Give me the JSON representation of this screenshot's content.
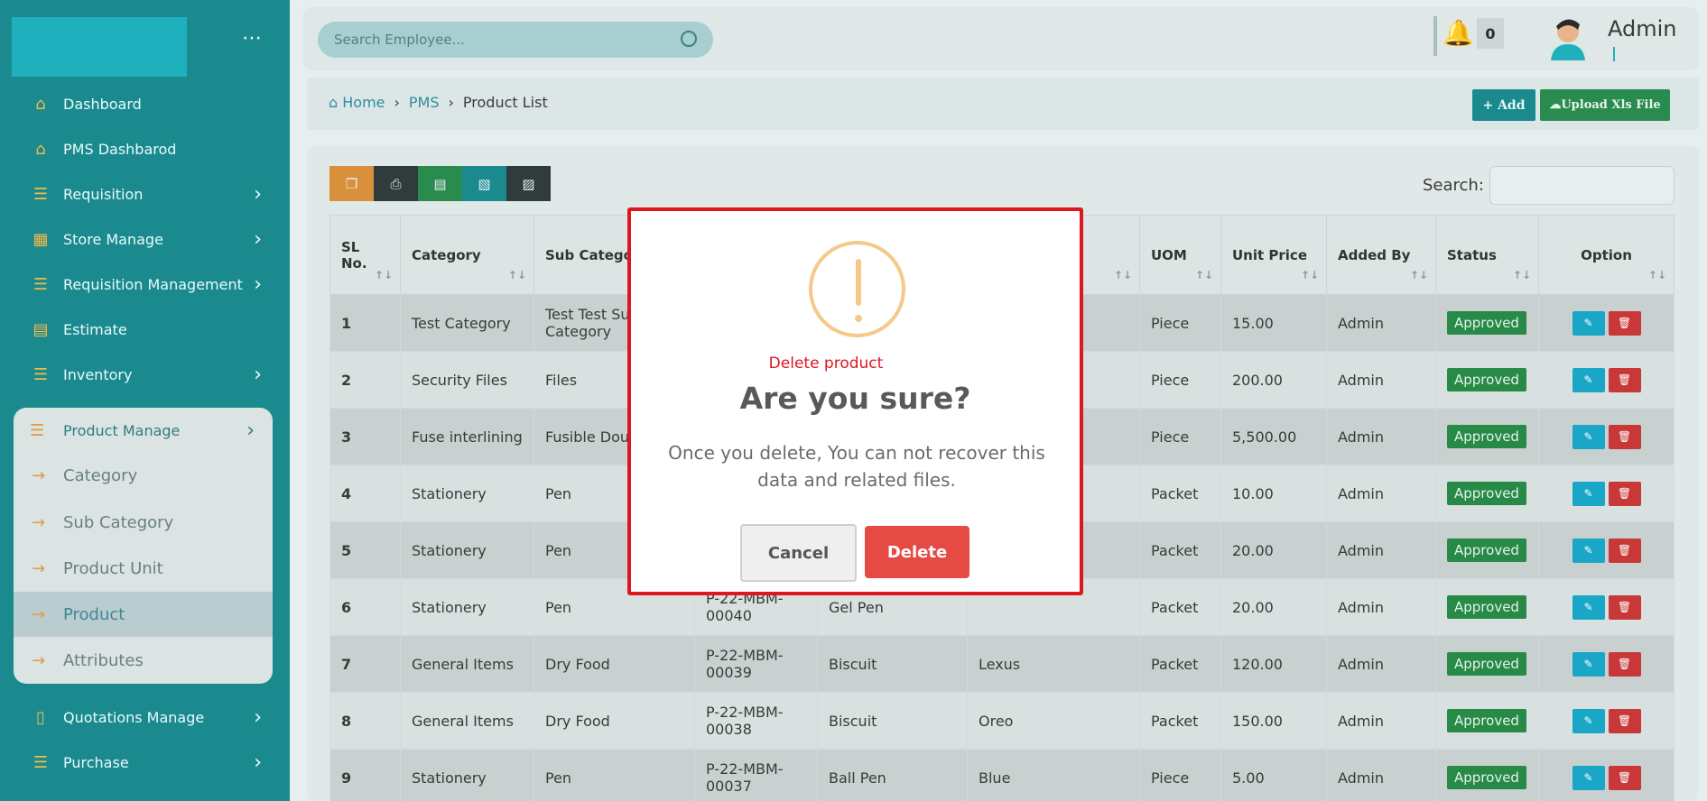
{
  "sidebar": {
    "items": [
      {
        "label": "Dashboard",
        "icon": "home-icon"
      },
      {
        "label": "PMS Dashbarod",
        "icon": "home-icon"
      },
      {
        "label": "Requisition",
        "icon": "list-icon"
      },
      {
        "label": "Store Manage",
        "icon": "store-icon"
      },
      {
        "label": "Requisition Management",
        "icon": "list-icon"
      },
      {
        "label": "Estimate",
        "icon": "calculator-icon"
      },
      {
        "label": "Inventory",
        "icon": "list-icon"
      }
    ],
    "product_manage": {
      "label": "Product Manage",
      "children": [
        "Category",
        "Sub Category",
        "Product Unit",
        "Product",
        "Attributes"
      ],
      "active": "Product"
    },
    "bottom_items": [
      {
        "label": "Quotations Manage",
        "icon": "document-icon"
      },
      {
        "label": "Purchase",
        "icon": "list-icon"
      }
    ]
  },
  "header": {
    "search_placeholder": "Search Employee...",
    "notification_count": "0",
    "user_name": "Admin"
  },
  "breadcrumb": {
    "home": "Home",
    "pms": "PMS",
    "current": "Product List"
  },
  "actions": {
    "add": "+ Add",
    "upload": "Upload Xls File"
  },
  "table": {
    "search_label": "Search:",
    "columns": [
      {
        "label": "SL No."
      },
      {
        "label": "Category"
      },
      {
        "label": "Sub Catego"
      },
      {
        "label": ""
      },
      {
        "label": ""
      },
      {
        "label": ""
      },
      {
        "label": "UOM"
      },
      {
        "label": "Unit Price"
      },
      {
        "label": "Added By"
      },
      {
        "label": "Status"
      },
      {
        "label": "Option"
      }
    ],
    "rows": [
      {
        "sl": "1",
        "category": "Test Category",
        "sub": "Test Test Su Category",
        "code": "",
        "name": "",
        "brand": "",
        "uom": "Piece",
        "price": "15.00",
        "by": "Admin",
        "status": "Approved"
      },
      {
        "sl": "2",
        "category": "Security Files",
        "sub": "Files",
        "code": "",
        "name": "",
        "brand": "",
        "uom": "Piece",
        "price": "200.00",
        "by": "Admin",
        "status": "Approved"
      },
      {
        "sl": "3",
        "category": "Fuse interlining",
        "sub": "Fusible Dou",
        "code": "",
        "name": "",
        "brand": "",
        "uom": "Piece",
        "price": "5,500.00",
        "by": "Admin",
        "status": "Approved"
      },
      {
        "sl": "4",
        "category": "Stationery",
        "sub": "Pen",
        "code": "",
        "name": "",
        "brand": "",
        "uom": "Packet",
        "price": "10.00",
        "by": "Admin",
        "status": "Approved"
      },
      {
        "sl": "5",
        "category": "Stationery",
        "sub": "Pen",
        "code": "",
        "name": "",
        "brand": "",
        "uom": "Packet",
        "price": "20.00",
        "by": "Admin",
        "status": "Approved"
      },
      {
        "sl": "6",
        "category": "Stationery",
        "sub": "Pen",
        "code": "P-22-MBM-00040",
        "name": "Gel Pen",
        "brand": "",
        "uom": "Packet",
        "price": "20.00",
        "by": "Admin",
        "status": "Approved"
      },
      {
        "sl": "7",
        "category": "General Items",
        "sub": "Dry Food",
        "code": "P-22-MBM-00039",
        "name": "Biscuit",
        "brand": "Lexus",
        "uom": "Packet",
        "price": "120.00",
        "by": "Admin",
        "status": "Approved"
      },
      {
        "sl": "8",
        "category": "General Items",
        "sub": "Dry Food",
        "code": "P-22-MBM-00038",
        "name": "Biscuit",
        "brand": "Oreo",
        "uom": "Packet",
        "price": "150.00",
        "by": "Admin",
        "status": "Approved"
      },
      {
        "sl": "9",
        "category": "Stationery",
        "sub": "Pen",
        "code": "P-22-MBM-00037",
        "name": "Ball Pen",
        "brand": "Blue",
        "uom": "Piece",
        "price": "5.00",
        "by": "Admin",
        "status": "Approved"
      }
    ]
  },
  "modal": {
    "label": "Delete product",
    "title": "Are you sure?",
    "text": "Once you delete, You can not recover this data and related files.",
    "cancel": "Cancel",
    "delete": "Delete"
  },
  "colors": {
    "sidebar": "#1a8a8f",
    "accent": "#1eb1bd",
    "approved": "#278a46",
    "danger": "#e64a45",
    "modal_border": "#e0161e"
  }
}
